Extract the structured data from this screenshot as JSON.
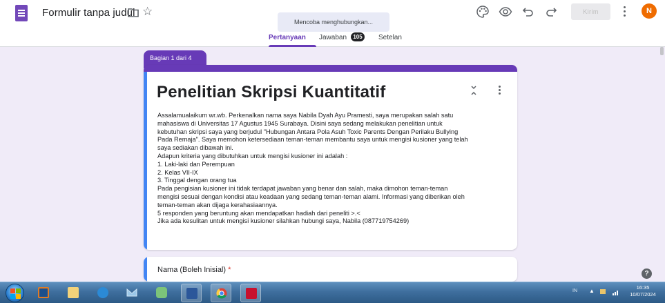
{
  "header": {
    "doc_title": "Formulir tanpa judul",
    "toast": "Mencoba menghubungkan...",
    "tabs": [
      {
        "label": "Pertanyaan",
        "active": true
      },
      {
        "label": "Jawaban",
        "active": false,
        "badge": "105"
      },
      {
        "label": "Setelan",
        "active": false
      }
    ],
    "send_label": "Kirim",
    "avatar_initial": "N",
    "icons": [
      "palette-icon",
      "preview-eye-icon",
      "undo-icon",
      "redo-icon"
    ]
  },
  "form": {
    "section_tab": "Bagian 1 dari 4",
    "title": "Penelitian Skripsi Kuantitatif",
    "description_lines": [
      "Assalamualaikum wr.wb. Perkenalkan nama saya Nabila Dyah Ayu Pramesti, saya merupakan salah satu",
      "mahasiswa di Universitas 17 Agustus 1945 Surabaya. Disini saya sedang melakukan penelitian untuk",
      "kebutuhan skripsi saya yang berjudul \"Hubungan Antara Pola Asuh Toxic Parents Dengan Perilaku Bullying",
      "Pada Remaja\". Saya memohon ketersediaan teman-teman membantu saya untuk mengisi kusioner yang telah",
      "saya sediakan dibawah ini.",
      "Adapun kriteria yang dibutuhkan untuk mengisi kusioner ini adalah :",
      "1. Laki-laki dan Perempuan",
      "2. Kelas VII-IX",
      "3. Tinggal dengan orang tua",
      "Pada pengisian kusioner ini tidak terdapat jawaban yang benar dan salah, maka dimohon teman-teman",
      "mengisi sesuai dengan kondisi atau keadaan yang sedang teman-teman alami. Informasi yang diberikan oleh",
      "teman-teman akan dijaga kerahasiaannya.",
      "5 responden yang beruntung akan mendapatkan hadiah dari peneliti >.<",
      "Jika ada kesulitan untuk mengisi kusioner silahkan hubungi saya, Nabila (087719754269)"
    ],
    "question": {
      "label": "Nama (Boleh Inisial)",
      "required_mark": "*"
    },
    "accent_color": "#673ab7",
    "focus_color": "#4285f4",
    "background_color": "#f0ebf8"
  },
  "help_label": "?",
  "taskbar": {
    "apps": [
      "windows-start",
      "media-player-icon",
      "file-explorer-icon",
      "internet-explorer-icon",
      "mail-icon",
      "chat-icon",
      "word-icon",
      "chrome-icon",
      "pdf-reader-icon"
    ],
    "tray_lang": "IN",
    "clock_time": "16:35",
    "clock_date": "10/07/2024"
  }
}
